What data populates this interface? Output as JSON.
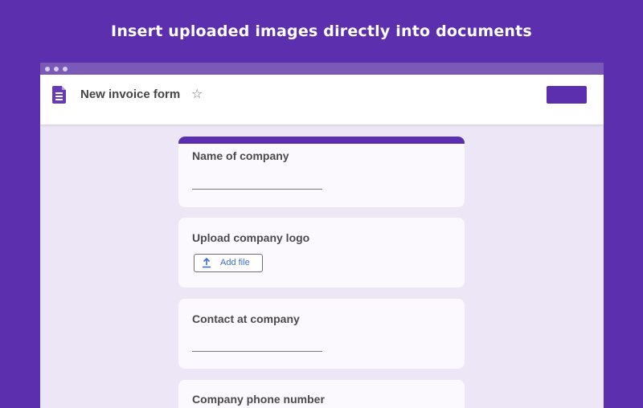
{
  "headline": "Insert uploaded images directly into documents",
  "app": {
    "title": "New invoice form",
    "send_label": ""
  },
  "form": {
    "questions": [
      {
        "title": "Name of company",
        "type": "short-answer"
      },
      {
        "title": "Upload company logo",
        "type": "file-upload",
        "button_label": "Add file"
      },
      {
        "title": "Contact at company",
        "type": "short-answer"
      },
      {
        "title": "Company phone number",
        "type": "short-answer"
      }
    ]
  },
  "colors": {
    "brand": "#5b2fae",
    "background": "#ece6f6",
    "link": "#3b6fd1"
  },
  "icons": [
    "forms-icon",
    "star-icon",
    "upload-icon"
  ]
}
